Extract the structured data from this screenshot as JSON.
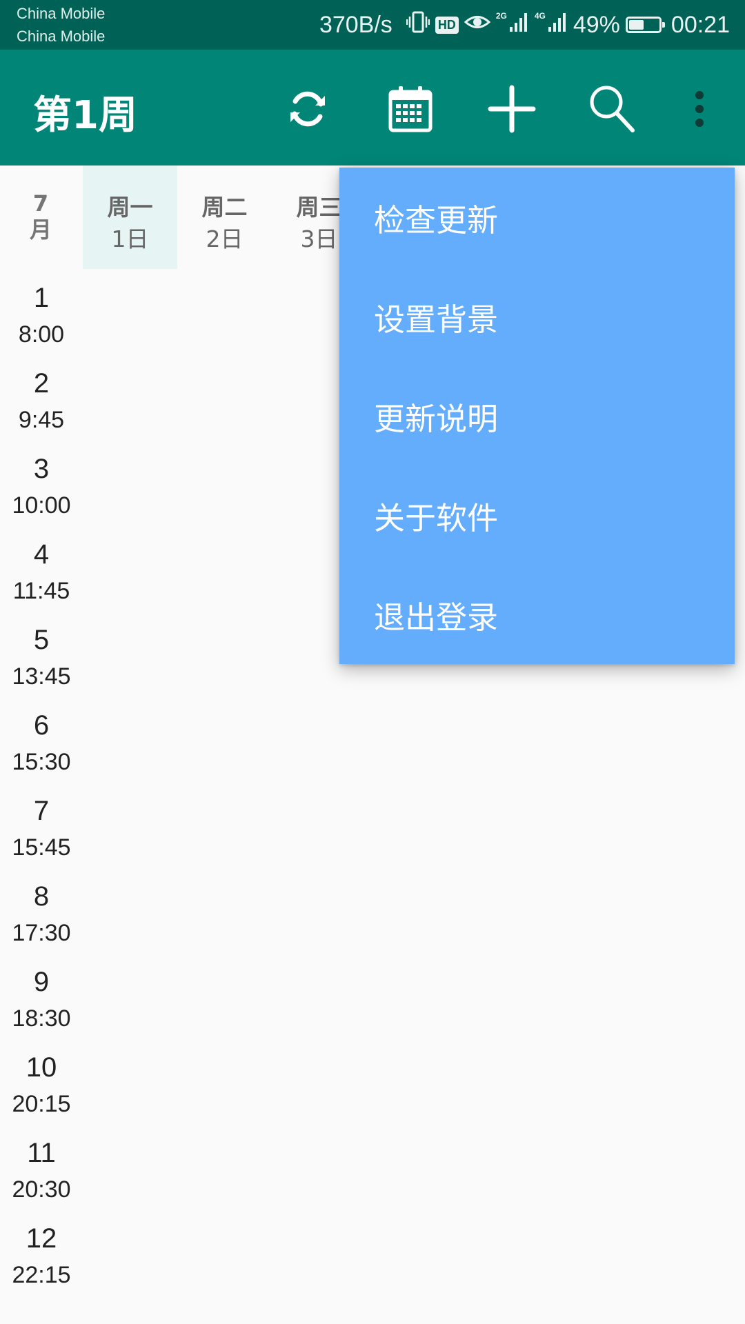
{
  "status_bar": {
    "carrier_1": "China Mobile",
    "carrier_2": "China Mobile",
    "net_speed": "370B/s",
    "hd_badge": "HD",
    "signal_1_label": "2G",
    "signal_2_label": "4G",
    "battery_percent": "49%",
    "battery_level": 0.49,
    "time": "00:21",
    "icons": [
      "vibrate-icon",
      "hd-icon",
      "eye-icon",
      "signal-2g-icon",
      "signal-4g-icon",
      "battery-icon"
    ]
  },
  "toolbar": {
    "title": "第1周",
    "actions": [
      "refresh-icon",
      "calendar-icon",
      "add-icon",
      "search-icon",
      "more-vert-icon"
    ],
    "color": "#008577",
    "status_color": "#006156"
  },
  "week_header": {
    "month_number": "7",
    "month_char": "月",
    "days": [
      {
        "name": "周一",
        "date": "1日",
        "today": true
      },
      {
        "name": "周二",
        "date": "2日",
        "today": false
      },
      {
        "name": "周三",
        "date": "3日",
        "today": false
      }
    ]
  },
  "time_slots": [
    {
      "num": "1",
      "time": "8:00"
    },
    {
      "num": "2",
      "time": "9:45"
    },
    {
      "num": "3",
      "time": "10:00"
    },
    {
      "num": "4",
      "time": "11:45"
    },
    {
      "num": "5",
      "time": "13:45"
    },
    {
      "num": "6",
      "time": "15:30"
    },
    {
      "num": "7",
      "time": "15:45"
    },
    {
      "num": "8",
      "time": "17:30"
    },
    {
      "num": "9",
      "time": "18:30"
    },
    {
      "num": "10",
      "time": "20:15"
    },
    {
      "num": "11",
      "time": "20:30"
    },
    {
      "num": "12",
      "time": "22:15"
    }
  ],
  "menu": {
    "background": "#64adfd",
    "items": [
      "检查更新",
      "设置背景",
      "更新说明",
      "关于软件",
      "退出登录"
    ]
  }
}
